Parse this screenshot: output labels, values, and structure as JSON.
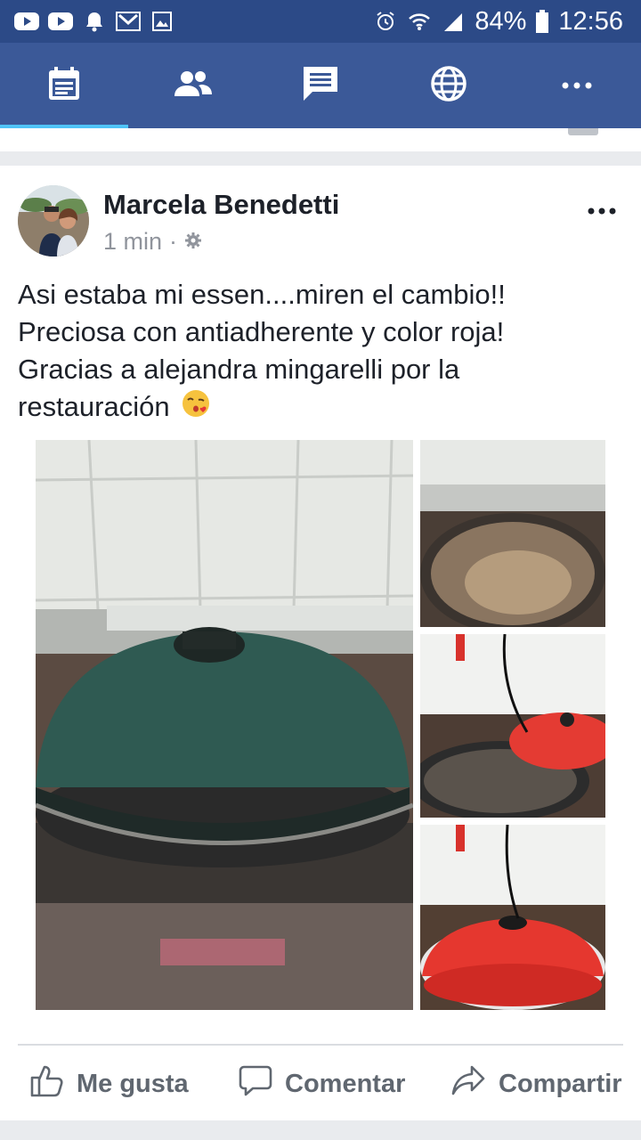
{
  "status_bar": {
    "battery": "84%",
    "time": "12:56",
    "icons": [
      "youtube-icon",
      "youtube-icon",
      "notification-bell-icon",
      "gmail-icon",
      "gallery-icon",
      "alarm-icon",
      "wifi-icon",
      "signal-icon",
      "battery-icon"
    ]
  },
  "nav": {
    "tabs": [
      {
        "icon": "news-feed-icon",
        "active": true
      },
      {
        "icon": "friends-icon",
        "active": false
      },
      {
        "icon": "messenger-icon",
        "active": false
      },
      {
        "icon": "globe-icon",
        "active": false
      },
      {
        "icon": "more-dots-icon",
        "active": false
      }
    ],
    "accent": "#3b5998",
    "active_indicator": "#4fc3f7"
  },
  "post": {
    "author": "Marcela Benedetti",
    "time": "1 min",
    "separator": "·",
    "privacy_icon": "gear-icon",
    "text_lines": [
      "Asi estaba mi essen....miren el cambio!!",
      "Preciosa con antiadherente y color roja!",
      "Gracias a alejandra mingarelli por la",
      "restauración"
    ],
    "emoji": "face-blowing-kiss",
    "photos": [
      "green-pot-on-stove",
      "old-pan",
      "red-lid-and-pan",
      "red-pot"
    ]
  },
  "actions": {
    "like": "Me gusta",
    "comment": "Comentar",
    "share": "Compartir"
  }
}
